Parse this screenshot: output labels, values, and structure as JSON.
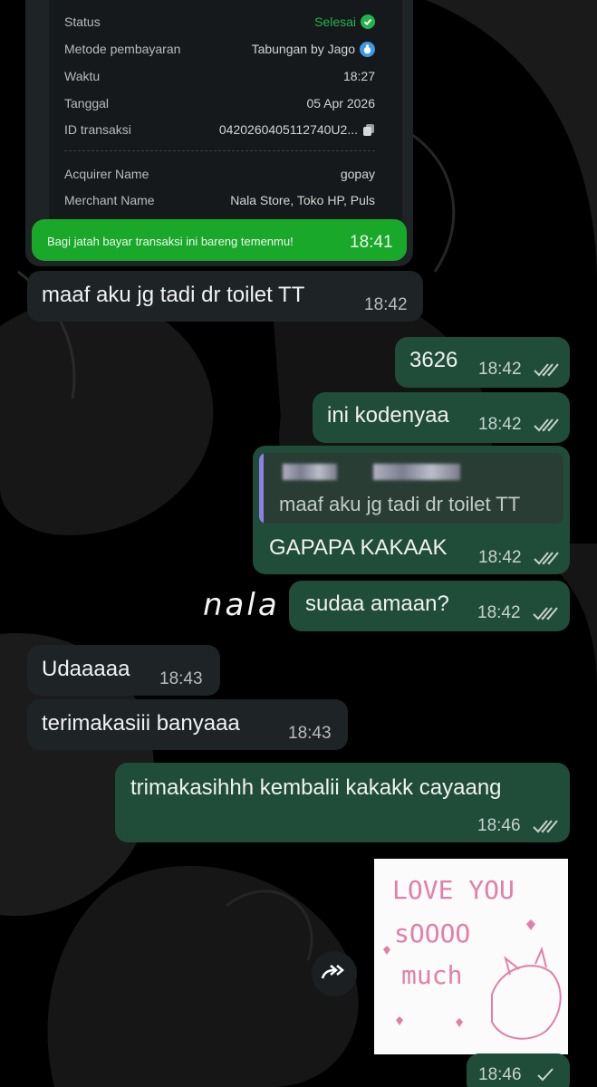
{
  "receipt": {
    "rows": [
      {
        "label": "Status",
        "value": "Selesai"
      },
      {
        "label": "Metode pembayaran",
        "value": "Tabungan by Jago"
      },
      {
        "label": "Waktu",
        "value": "18:27"
      },
      {
        "label": "Tanggal",
        "value": "05 Apr 2026"
      },
      {
        "label": "ID transaksi",
        "value": "0420260405112740U2..."
      },
      {
        "label": "Acquirer Name",
        "value": "gopay"
      },
      {
        "label": "Merchant Name",
        "value": "Nala Store, Toko HP, Puls"
      }
    ],
    "banner_text": "Bagi jatah bayar transaksi ini bareng temenmu!",
    "time": "18:41"
  },
  "messages": [
    {
      "dir": "in",
      "text": "maaf aku jg tadi dr toilet TT",
      "time": "18:42"
    },
    {
      "dir": "out",
      "text": "3626",
      "time": "18:42"
    },
    {
      "dir": "out",
      "text": "ini kodenyaa",
      "time": "18:42"
    },
    {
      "dir": "out",
      "quote": "maaf aku jg tadi dr toilet TT",
      "text": "GAPAPA KAKAAK",
      "time": "18:42"
    },
    {
      "dir": "out",
      "text": "sudaa amaan?",
      "time": "18:42"
    },
    {
      "dir": "in",
      "text": "Udaaaaa",
      "time": "18:43"
    },
    {
      "dir": "in",
      "text": "terimakasiii banyaaa",
      "time": "18:43"
    },
    {
      "dir": "out",
      "text": "trimakasihhh kembalii kakakk cayaang",
      "time": "18:46"
    },
    {
      "dir": "out",
      "image": "love-you-sticker",
      "time": "18:46"
    }
  ],
  "sticker_text": {
    "line1": "LOVE YOU",
    "line2": "sOOOO",
    "line3": "much"
  },
  "overlay_handwriting": "nala",
  "colors": {
    "incoming": "#1e2326",
    "outgoing": "#1f4d3a",
    "status": "#1aa82a",
    "quote_bar": "#8f7fe6"
  }
}
